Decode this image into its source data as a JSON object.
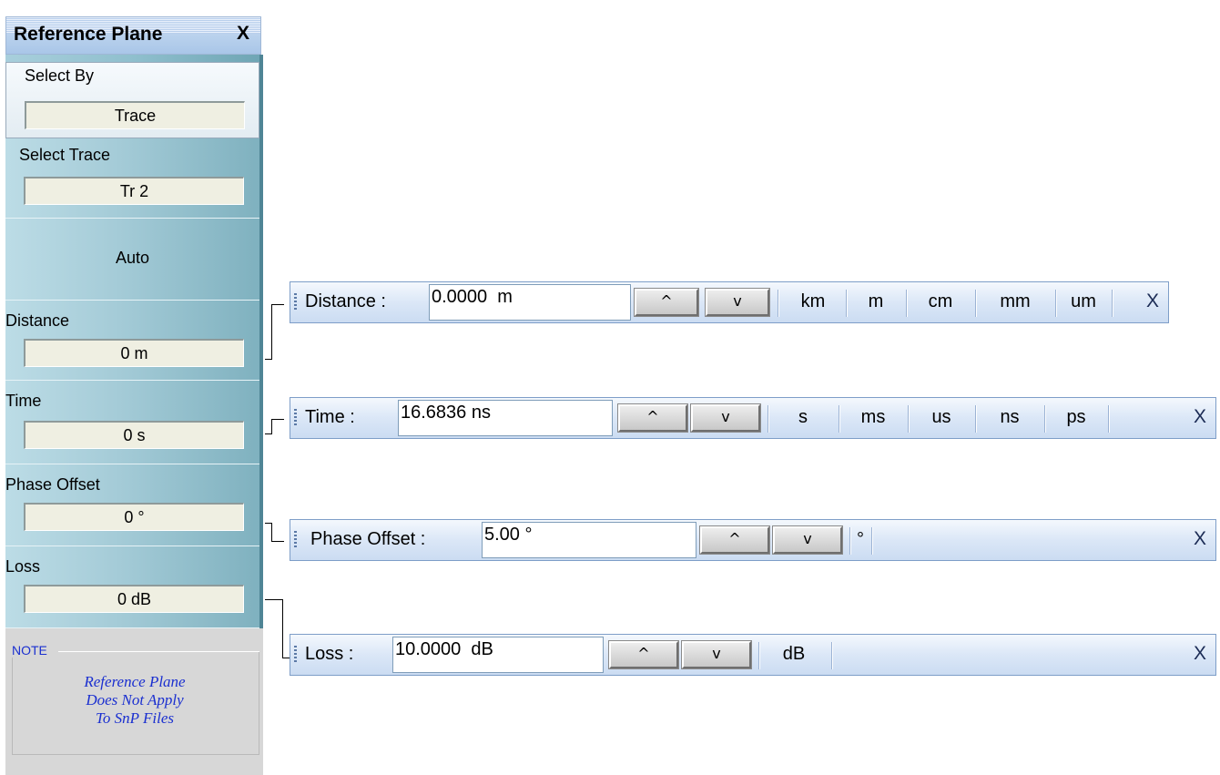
{
  "panel": {
    "title": "Reference Plane",
    "close_label": "X",
    "select_by": {
      "label": "Select By",
      "value": "Trace"
    },
    "select_trace": {
      "label": "Select Trace",
      "value": "Tr 2"
    },
    "auto_label": "Auto",
    "distance": {
      "label": "Distance",
      "value": "0 m"
    },
    "time": {
      "label": "Time",
      "value": "0 s"
    },
    "phase_offset": {
      "label": "Phase Offset",
      "value": "0 °"
    },
    "loss": {
      "label": "Loss",
      "value": "0 dB"
    },
    "note": {
      "heading": "NOTE",
      "lines": [
        "Reference Plane",
        "Does Not Apply",
        "To SnP Files"
      ]
    }
  },
  "toolbars": {
    "distance": {
      "label": "Distance :",
      "value": "0.0000  m",
      "units": [
        "km",
        "m",
        "cm",
        "mm",
        "um"
      ],
      "close_label": "X"
    },
    "time": {
      "label": "Time :",
      "value": "16.6836 ns",
      "units": [
        "s",
        "ms",
        "us",
        "ns",
        "ps"
      ],
      "close_label": "X"
    },
    "phase_offset": {
      "label": "Phase Offset :",
      "value": "5.00 °",
      "units": [
        "°"
      ],
      "close_label": "X"
    },
    "loss": {
      "label": "Loss :",
      "value": "10.0000  dB",
      "units": [
        "dB"
      ],
      "close_label": "X"
    },
    "up_arrow": "^",
    "down_arrow": "v"
  },
  "colors": {
    "menu_accent": "#8fbfcd",
    "toolbar_bg": "#dbe7f7",
    "note_text": "#1a2fd0"
  }
}
